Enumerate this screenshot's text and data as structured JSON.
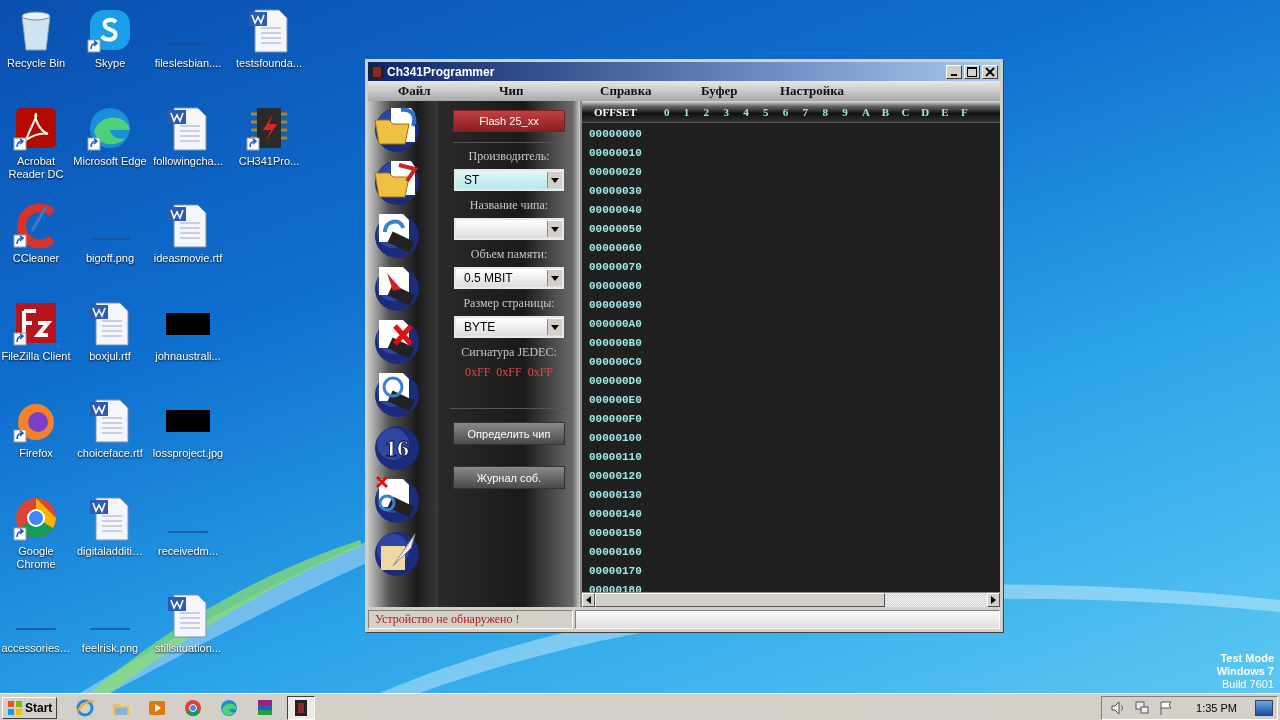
{
  "desktop": {
    "icons": [
      {
        "label": "Recycle Bin",
        "kind": "recycle",
        "shortcut": false
      },
      {
        "label": "Acrobat Reader DC",
        "kind": "pdf",
        "shortcut": true
      },
      {
        "label": "CCleaner",
        "kind": "ccleaner",
        "shortcut": true
      },
      {
        "label": "FileZilla Client",
        "kind": "filezilla",
        "shortcut": true
      },
      {
        "label": "Firefox",
        "kind": "firefox",
        "shortcut": true
      },
      {
        "label": "Google Chrome",
        "kind": "chrome",
        "shortcut": true
      },
      {
        "label": "accessories…",
        "kind": "blank",
        "shortcut": false
      },
      {
        "label": "Skype",
        "kind": "skype",
        "shortcut": true
      },
      {
        "label": "Microsoft Edge",
        "kind": "edge",
        "shortcut": true
      },
      {
        "label": "bigoff.png",
        "kind": "blank",
        "shortcut": false
      },
      {
        "label": "boxjul.rtf",
        "kind": "word",
        "shortcut": false
      },
      {
        "label": "choiceface.rtf",
        "kind": "word",
        "shortcut": false
      },
      {
        "label": "digitaladditi…",
        "kind": "word",
        "shortcut": false
      },
      {
        "label": "feelrisk.png",
        "kind": "blank",
        "shortcut": false
      },
      {
        "label": "fileslesbian....",
        "kind": "blank",
        "shortcut": false
      },
      {
        "label": "followingcha...",
        "kind": "word",
        "shortcut": false
      },
      {
        "label": "ideasmovie.rtf",
        "kind": "word",
        "shortcut": false
      },
      {
        "label": "johnaustrali...",
        "kind": "black",
        "shortcut": false
      },
      {
        "label": "lossproject.jpg",
        "kind": "black",
        "shortcut": false
      },
      {
        "label": "receivedm...",
        "kind": "blank",
        "shortcut": false
      },
      {
        "label": "stillsituation...",
        "kind": "word",
        "shortcut": false
      },
      {
        "label": "testsfounda...",
        "kind": "word",
        "shortcut": false
      },
      {
        "label": "CH341Pro...",
        "kind": "chip",
        "shortcut": true
      }
    ],
    "test_mode": [
      "Test Mode",
      "Windows 7",
      "Build 7601"
    ]
  },
  "window": {
    "title": "Ch341Programmer",
    "menu": [
      "Файл",
      "Чип",
      "Справка",
      "Буфер",
      "Настройка"
    ],
    "toolbar": [
      {
        "kind": "open"
      },
      {
        "kind": "save"
      },
      {
        "kind": "read"
      },
      {
        "kind": "write"
      },
      {
        "kind": "erase"
      },
      {
        "kind": "verify"
      },
      {
        "kind": "number",
        "text": "16"
      },
      {
        "kind": "erase-verify"
      },
      {
        "kind": "edit"
      }
    ],
    "family_button": "Flash 25_xx",
    "fields": [
      {
        "label": "Производитель:",
        "value": "ST",
        "focused": true
      },
      {
        "label": "Название чипа:",
        "focused": false
      },
      {
        "label": "Объем памяти:",
        "value": "0.5 MBIT",
        "focused": false
      },
      {
        "label": "Размер страницы:",
        "value": "BYTE",
        "focused": false
      }
    ],
    "signature_label": "Сигнатура JEDEC:",
    "signature": [
      "0xFF",
      "0xFF",
      "0xFF"
    ],
    "buttons": [
      "Определить чип",
      "Журнал соб."
    ],
    "hex": {
      "offset_header": "OFFSET",
      "columns": [
        "0",
        "1",
        "2",
        "3",
        "4",
        "5",
        "6",
        "7",
        "8",
        "9",
        "A",
        "B",
        "C",
        "D",
        "E",
        "F"
      ],
      "offsets": [
        "00000000",
        "00000010",
        "00000020",
        "00000030",
        "00000040",
        "00000050",
        "00000060",
        "00000070",
        "00000080",
        "00000090",
        "000000A0",
        "000000B0",
        "000000C0",
        "000000D0",
        "000000E0",
        "000000F0",
        "00000100",
        "00000110",
        "00000120",
        "00000130",
        "00000140",
        "00000150",
        "00000160",
        "00000170",
        "00000180"
      ]
    },
    "status": "Устройство не обнаружено !"
  },
  "taskbar": {
    "start": "Start",
    "apps": [
      {
        "kind": "ie",
        "active": false
      },
      {
        "kind": "explorer",
        "active": false
      },
      {
        "kind": "media",
        "active": false
      },
      {
        "kind": "chrome",
        "active": false
      },
      {
        "kind": "edge",
        "active": false
      },
      {
        "kind": "winrar",
        "active": false
      },
      {
        "kind": "ch341",
        "active": true
      }
    ],
    "clock": "1:35 PM"
  }
}
